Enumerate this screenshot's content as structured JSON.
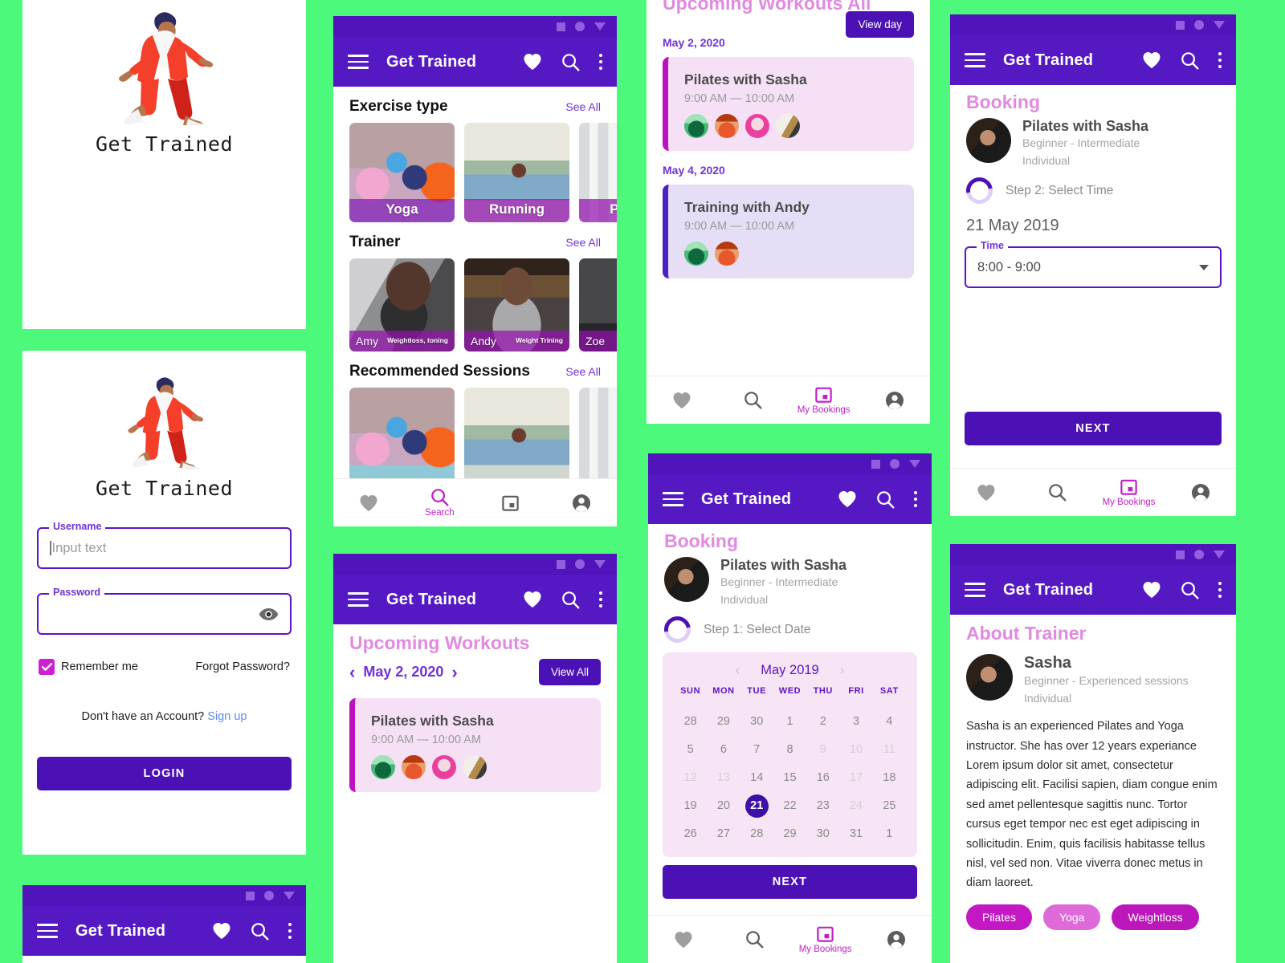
{
  "background_color": "#4df97a",
  "accent": {
    "purple": "#5519c4",
    "deep_purple": "#4b11b5",
    "magenta": "#c31fc8",
    "pink_title": "#e08ae0"
  },
  "app": {
    "name": "Get Trained",
    "bar_title": "Get Trained"
  },
  "icons": {
    "menu": "hamburger-menu-icon",
    "favorite": "heart-icon",
    "search": "search-icon",
    "overflow": "kebab-menu-icon",
    "eye": "eye-visibility-icon",
    "calendar": "calendar-icon",
    "account": "account-circle-icon",
    "dropdown": "chevron-down-icon"
  },
  "splash": {
    "title": "Get Trained"
  },
  "login": {
    "title": "Get Trained",
    "username_label": "Username",
    "username_value": "Input text",
    "password_label": "Password",
    "password_value": "",
    "remember_label": "Remember me",
    "forgot_label": "Forgot Password?",
    "signup_prompt": "Don't have an Account?",
    "signup_link": "Sign up",
    "login_button": "LOGIN"
  },
  "home": {
    "sections": [
      {
        "title": "Exercise type",
        "see_all": "See All",
        "cards": [
          {
            "label": "Yoga",
            "art": "ph-yoga"
          },
          {
            "label": "Running",
            "art": "ph-run"
          },
          {
            "label": "Pilates",
            "art": "ph-pil"
          }
        ]
      },
      {
        "title": "Trainer",
        "see_all": "See All",
        "cards": [
          {
            "label": "Amy",
            "spec": "Weightloss, toning",
            "art": "ph-amy"
          },
          {
            "label": "Andy",
            "spec": "Weight Trining",
            "art": "ph-andy"
          },
          {
            "label": "Zoe",
            "spec": "",
            "art": "ph-zoe"
          }
        ]
      },
      {
        "title": "Recommended Sessions",
        "see_all": "See All",
        "cards": [
          {
            "label": "",
            "art": "ph-yoga"
          },
          {
            "label": "",
            "art": "ph-run"
          },
          {
            "label": "",
            "art": "ph-pil"
          }
        ]
      }
    ],
    "nav": {
      "active": "Search",
      "search_label": "Search"
    }
  },
  "upcoming_day": {
    "title": "Upcoming Workouts",
    "date": "May 2, 2020",
    "prev": "‹",
    "next": "›",
    "view_all_button": "View All",
    "workout": {
      "title": "Pilates with Sasha",
      "time": "9:00 AM — 10:00 AM",
      "attendees": 4
    }
  },
  "upcoming_all": {
    "title": "Upcoming Workouts All",
    "view_day_button": "View day",
    "groups": [
      {
        "date": "May 2, 2020",
        "workout": {
          "title": "Pilates with Sasha",
          "time": "9:00 AM — 10:00 AM",
          "attendees": 4,
          "accent": "magenta"
        }
      },
      {
        "date": "May 4, 2020",
        "workout": {
          "title": "Training with Andy",
          "time": "9:00 AM — 10:00 AM",
          "attendees": 2,
          "accent": "blue"
        }
      }
    ],
    "nav": {
      "active": "My Bookings",
      "bookings_label": "My Bookings"
    }
  },
  "booking_step1": {
    "title": "Booking",
    "session_title": "Pilates with Sasha",
    "level": "Beginner - Intermediate",
    "type": "Individual",
    "step": "Step 1: Select Date",
    "calendar": {
      "month": "May 2019",
      "dow": [
        "SUN",
        "MON",
        "TUE",
        "WED",
        "THU",
        "FRI",
        "SAT"
      ],
      "weeks": [
        [
          {
            "d": "28",
            "s": "normal"
          },
          {
            "d": "29",
            "s": "normal"
          },
          {
            "d": "30",
            "s": "normal"
          },
          {
            "d": "1",
            "s": "normal"
          },
          {
            "d": "2",
            "s": "normal"
          },
          {
            "d": "3",
            "s": "normal"
          },
          {
            "d": "4",
            "s": "normal"
          }
        ],
        [
          {
            "d": "5",
            "s": "normal"
          },
          {
            "d": "6",
            "s": "normal"
          },
          {
            "d": "7",
            "s": "normal"
          },
          {
            "d": "8",
            "s": "normal"
          },
          {
            "d": "9",
            "s": "dim"
          },
          {
            "d": "10",
            "s": "dim"
          },
          {
            "d": "11",
            "s": "dim"
          }
        ],
        [
          {
            "d": "12",
            "s": "dim"
          },
          {
            "d": "13",
            "s": "dim"
          },
          {
            "d": "14",
            "s": "normal"
          },
          {
            "d": "15",
            "s": "normal"
          },
          {
            "d": "16",
            "s": "normal"
          },
          {
            "d": "17",
            "s": "dim"
          },
          {
            "d": "18",
            "s": "normal"
          }
        ],
        [
          {
            "d": "19",
            "s": "normal"
          },
          {
            "d": "20",
            "s": "normal"
          },
          {
            "d": "21",
            "s": "selected"
          },
          {
            "d": "22",
            "s": "normal"
          },
          {
            "d": "23",
            "s": "normal"
          },
          {
            "d": "24",
            "s": "dim"
          },
          {
            "d": "25",
            "s": "normal"
          }
        ],
        [
          {
            "d": "26",
            "s": "normal"
          },
          {
            "d": "27",
            "s": "normal"
          },
          {
            "d": "28",
            "s": "normal"
          },
          {
            "d": "29",
            "s": "normal"
          },
          {
            "d": "30",
            "s": "normal"
          },
          {
            "d": "31",
            "s": "normal"
          },
          {
            "d": "1",
            "s": "normal"
          }
        ]
      ],
      "selected_day": "21"
    },
    "next_button": "NEXT",
    "nav": {
      "active": "My Bookings",
      "bookings_label": "My Bookings"
    }
  },
  "booking_step2": {
    "title": "Booking",
    "session_title": "Pilates with Sasha",
    "level": "Beginner - Intermediate",
    "type": "Individual",
    "step": "Step 2: Select Time",
    "selected_date": "21 May 2019",
    "time_label": "Time",
    "time_value": "8:00 - 9:00",
    "next_button": "NEXT",
    "nav": {
      "active": "My Bookings",
      "bookings_label": "My Bookings"
    }
  },
  "about_trainer": {
    "title": "About Trainer",
    "name": "Sasha",
    "level": "Beginner - Experienced sessions",
    "type": "Individual",
    "bio": "Sasha is an experienced Pilates and Yoga instructor. She has over 12 years experiance Lorem ipsum dolor sit amet, consectetur adipiscing elit. Facilisi sapien, diam congue enim sed amet pellentesque sagittis nunc. Tortor cursus eget tempor nec est eget adipiscing in sollicitudin. Enim, quis facilisis habitasse tellus nisl, vel sed non. Vitae viverra donec metus in diam laoreet.",
    "tags": [
      "Pilates",
      "Yoga",
      "Weightloss"
    ]
  }
}
